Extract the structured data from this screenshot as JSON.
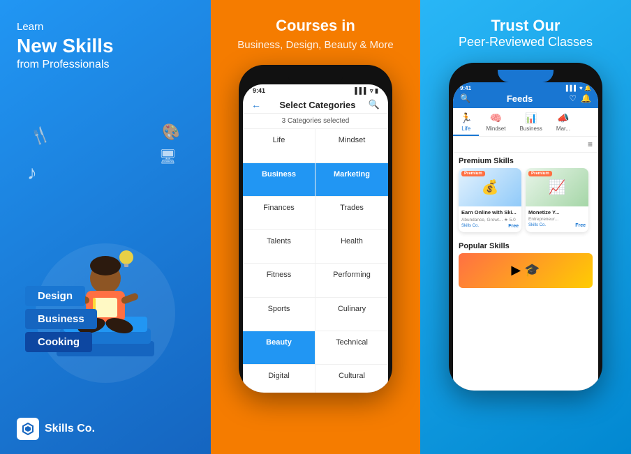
{
  "panel1": {
    "title": "Learn",
    "headline": "New Skills",
    "sub": "from Professionals",
    "books": [
      {
        "label": "Design",
        "class": "book-design"
      },
      {
        "label": "Business",
        "class": "book-business"
      },
      {
        "label": "Cooking",
        "class": "book-cooking"
      }
    ],
    "logo_text": "Skills Co.",
    "logo_symbol": "⟳"
  },
  "panel2": {
    "title": "Courses in",
    "subtitle": "Business, Design, Beauty & More",
    "phone": {
      "status_time": "9:41",
      "status_signal": "▌▌▌",
      "status_wifi": "▿",
      "status_battery": "▮",
      "nav_title": "Select Categories",
      "selected_info": "3 Categories selected",
      "categories": [
        {
          "label": "Life",
          "selected": false
        },
        {
          "label": "Mindset",
          "selected": false
        },
        {
          "label": "Business",
          "selected": true
        },
        {
          "label": "Marketing",
          "selected": true
        },
        {
          "label": "Finances",
          "selected": false
        },
        {
          "label": "Trades",
          "selected": false
        },
        {
          "label": "Talents",
          "selected": false
        },
        {
          "label": "Health",
          "selected": false
        },
        {
          "label": "Fitness",
          "selected": false
        },
        {
          "label": "Performing",
          "selected": false
        },
        {
          "label": "Sports",
          "selected": false
        },
        {
          "label": "Culinary",
          "selected": false
        },
        {
          "label": "Beauty",
          "selected": true
        },
        {
          "label": "Technical",
          "selected": false
        },
        {
          "label": "Digital",
          "selected": false
        },
        {
          "label": "Cultural",
          "selected": false
        }
      ]
    }
  },
  "panel3": {
    "title": "Trust Our",
    "subtitle": "Peer-Reviewed Classes",
    "phone": {
      "status_time": "9:41",
      "top_title": "Feeds",
      "tabs": [
        {
          "label": "Life",
          "icon": "🏃",
          "active": true
        },
        {
          "label": "Mindset",
          "icon": "🧠",
          "active": false
        },
        {
          "label": "Business",
          "icon": "📊",
          "active": false
        },
        {
          "label": "Mar...",
          "icon": "📣",
          "active": false
        }
      ],
      "sections": {
        "premium": {
          "label": "Premium Skills",
          "cards": [
            {
              "badge": "Premium",
              "title": "Earn Online with Ski...",
              "sub": "Abundance, Growt... ★ 5.0",
              "brand": "Skills Co.",
              "price": "Free",
              "emoji": "💰"
            },
            {
              "badge": "Premium",
              "title": "Monetize Y...",
              "sub": "Entrepreneur...",
              "brand": "Skills Co.",
              "price": "Free",
              "emoji": "📈"
            }
          ]
        },
        "popular": {
          "label": "Popular Skills"
        }
      }
    }
  }
}
